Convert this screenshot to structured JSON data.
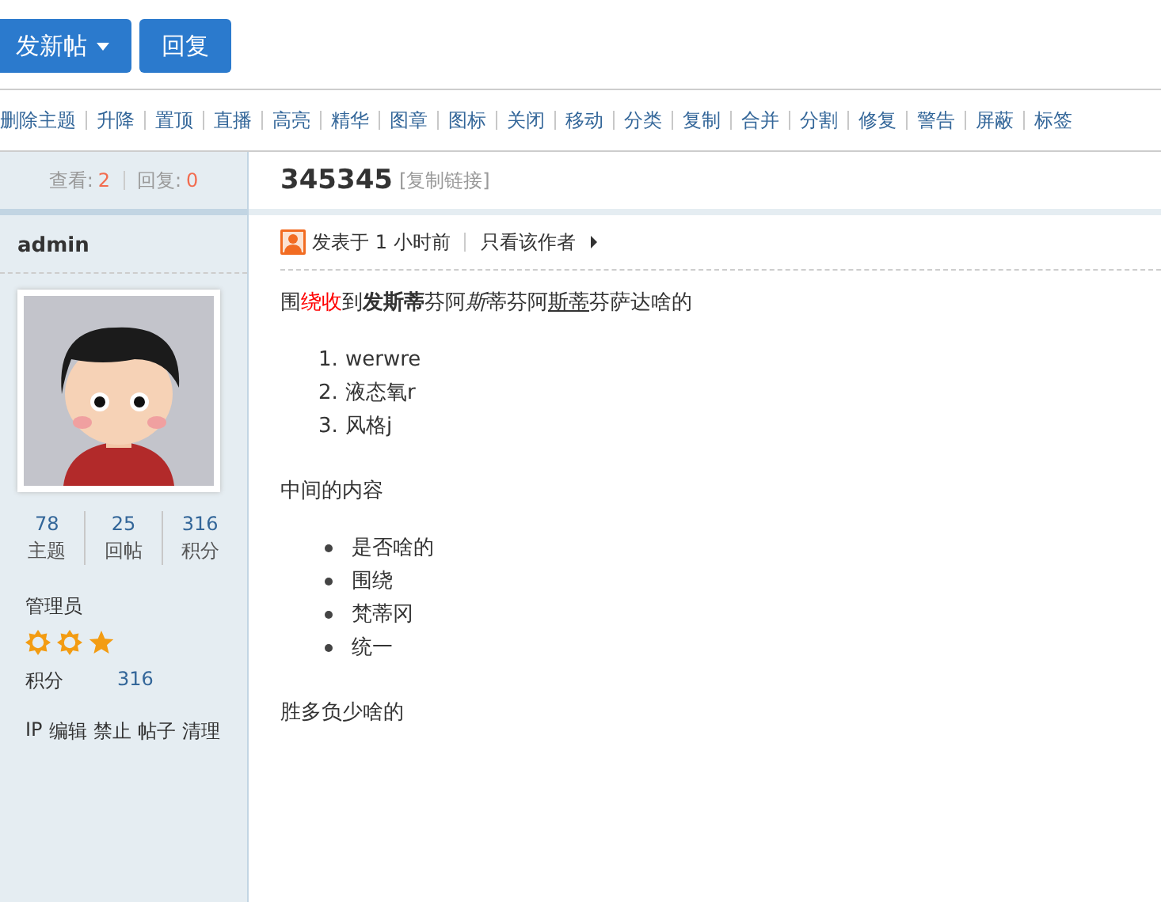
{
  "toolbar": {
    "buttons": [
      {
        "label": "发新帖",
        "dropdown": true
      },
      {
        "label": "回复",
        "dropdown": false
      }
    ]
  },
  "mod_actions": [
    "删除主题",
    "升降",
    "置顶",
    "直播",
    "高亮",
    "精华",
    "图章",
    "图标",
    "关闭",
    "移动",
    "分类",
    "复制",
    "合并",
    "分割",
    "修复",
    "警告",
    "屏蔽",
    "标签"
  ],
  "sidebar": {
    "views_label": "查看:",
    "views": "2",
    "replies_label": "回复:",
    "replies": "0",
    "author": "admin",
    "stats": [
      {
        "value": "78",
        "label": "主题"
      },
      {
        "value": "25",
        "label": "回帖"
      },
      {
        "value": "316",
        "label": "积分"
      }
    ],
    "group": "管理员",
    "rank_icons": [
      {
        "kind": "sun"
      },
      {
        "kind": "sun"
      },
      {
        "kind": "star"
      }
    ],
    "points_label": "积分",
    "points": "316",
    "admin_links": [
      "IP",
      "编辑",
      "禁止",
      "帖子",
      "清理"
    ]
  },
  "post": {
    "title": "345345",
    "copy_link": "[复制链接]",
    "posted": "发表于 1 小时前",
    "author_only": "只看该作者",
    "body": [
      {
        "kind": "paragraph",
        "segments": [
          {
            "text": "围",
            "kind": "plain"
          },
          {
            "text": "绕收",
            "kind": "red"
          },
          {
            "text": "到",
            "kind": "plain"
          },
          {
            "text": "发斯蒂",
            "kind": "bold"
          },
          {
            "text": "芬阿",
            "kind": "plain"
          },
          {
            "text": "斯",
            "kind": "italic"
          },
          {
            "text": "蒂芬阿",
            "kind": "plain"
          },
          {
            "text": "斯蒂",
            "kind": "underline"
          },
          {
            "text": "芬萨达啥的",
            "kind": "plain"
          }
        ]
      },
      {
        "kind": "ordered",
        "items": [
          {
            "marker": "1.",
            "text": "werwre"
          },
          {
            "marker": "2.",
            "text": "液态氧r"
          },
          {
            "marker": "3.",
            "text": "风格j"
          }
        ]
      },
      {
        "kind": "paragraph",
        "segments": [
          {
            "text": "中间的内容",
            "kind": "plain"
          }
        ]
      },
      {
        "kind": "bullets",
        "items": [
          {
            "text": "是否啥的"
          },
          {
            "text": "围绕"
          },
          {
            "text": "梵蒂冈"
          },
          {
            "text": "统一"
          }
        ]
      },
      {
        "kind": "paragraph",
        "segments": [
          {
            "text": "胜多负少啥的",
            "kind": "plain"
          }
        ]
      }
    ]
  }
}
